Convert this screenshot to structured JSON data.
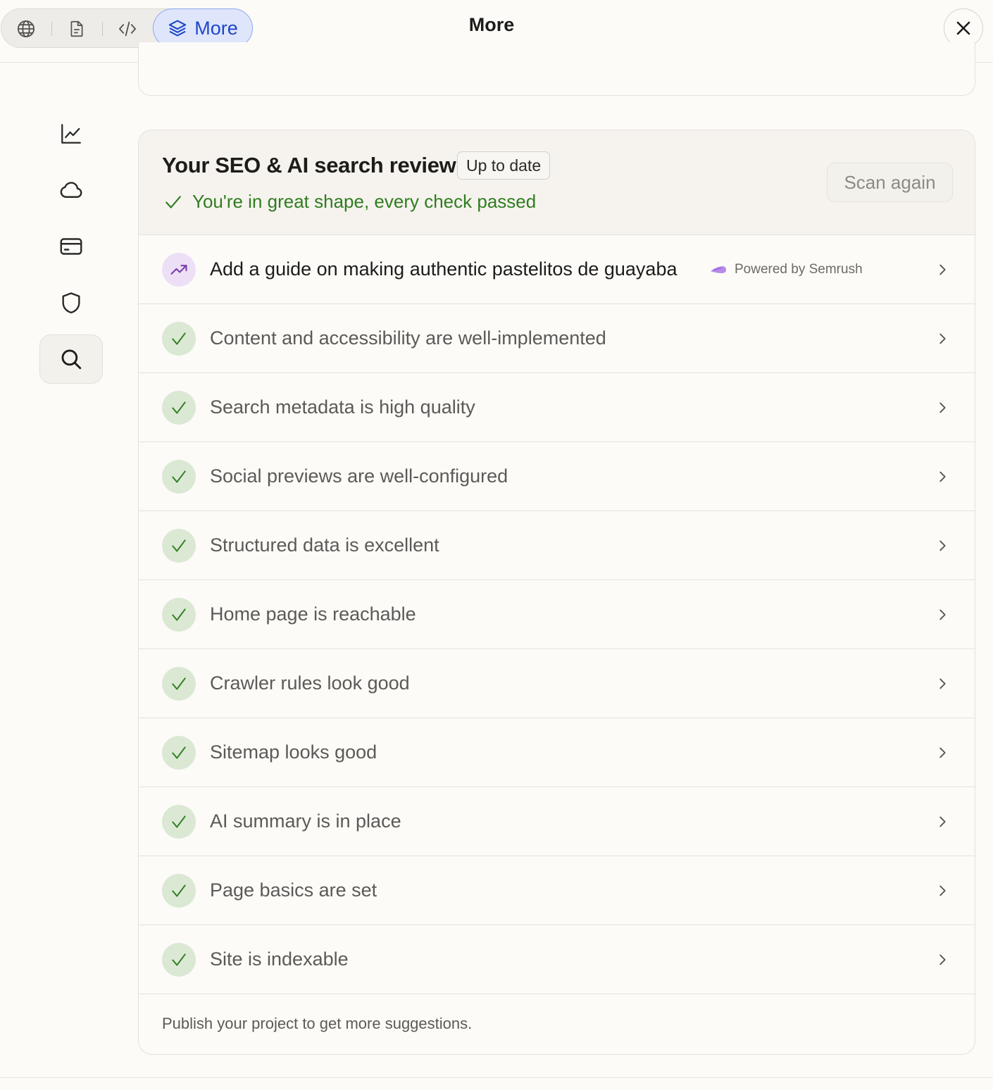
{
  "topbar": {
    "tabs": [
      {
        "name": "globe",
        "icon": "globe-icon"
      },
      {
        "name": "page",
        "icon": "document-icon"
      },
      {
        "name": "code",
        "icon": "code-icon"
      }
    ],
    "active_tab_label": "More",
    "title": "More"
  },
  "sidebar": {
    "items": [
      {
        "icon": "analytics-chart-icon",
        "active": false
      },
      {
        "icon": "cloud-icon",
        "active": false
      },
      {
        "icon": "credit-card-icon",
        "active": false
      },
      {
        "icon": "shield-icon",
        "active": false
      },
      {
        "icon": "search-icon",
        "active": true
      }
    ]
  },
  "review": {
    "title": "Your SEO & AI search review",
    "badge": "Up to date",
    "status": "You're in great shape, every check passed",
    "scan_button": "Scan again",
    "suggestion": {
      "label": "Add a guide on making authentic pastelitos de guayaba",
      "powered_by": "Powered by Semrush"
    },
    "checks": [
      "Content and accessibility are well-implemented",
      "Search metadata is high quality",
      "Social previews are well-configured",
      "Structured data is excellent",
      "Home page is reachable",
      "Crawler rules look good",
      "Sitemap looks good",
      "AI summary is in place",
      "Page basics are set",
      "Site is indexable"
    ],
    "footer_note": "Publish your project to get more suggestions."
  },
  "colors": {
    "accent_blue": "#1f46c9",
    "success_green": "#2f7d20",
    "suggestion_purple": "#7a3fb0"
  }
}
